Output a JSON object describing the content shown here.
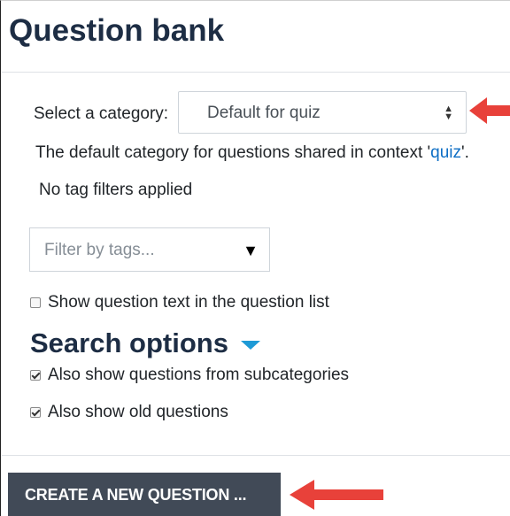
{
  "page": {
    "title": "Question bank"
  },
  "category": {
    "label": "Select a category:",
    "selected": "Default for quiz",
    "description_prefix": "The default category for questions shared in context '",
    "description_link": "quiz",
    "description_suffix": "'."
  },
  "tags": {
    "status": "No tag filters applied",
    "placeholder": "Filter by tags..."
  },
  "options": {
    "show_question_text": {
      "label": "Show question text in the question list",
      "checked": false
    }
  },
  "search_options": {
    "heading": "Search options",
    "subcategories": {
      "label": "Also show questions from subcategories",
      "checked": true
    },
    "old_questions": {
      "label": "Also show old questions",
      "checked": true
    }
  },
  "actions": {
    "create_label": "CREATE A NEW QUESTION ..."
  },
  "colors": {
    "heading": "#1d2d44",
    "link": "#0f6fc5",
    "button_bg": "#414a57",
    "annotation_arrow": "#e8413a",
    "collapse_icon": "#1e9ad6"
  }
}
